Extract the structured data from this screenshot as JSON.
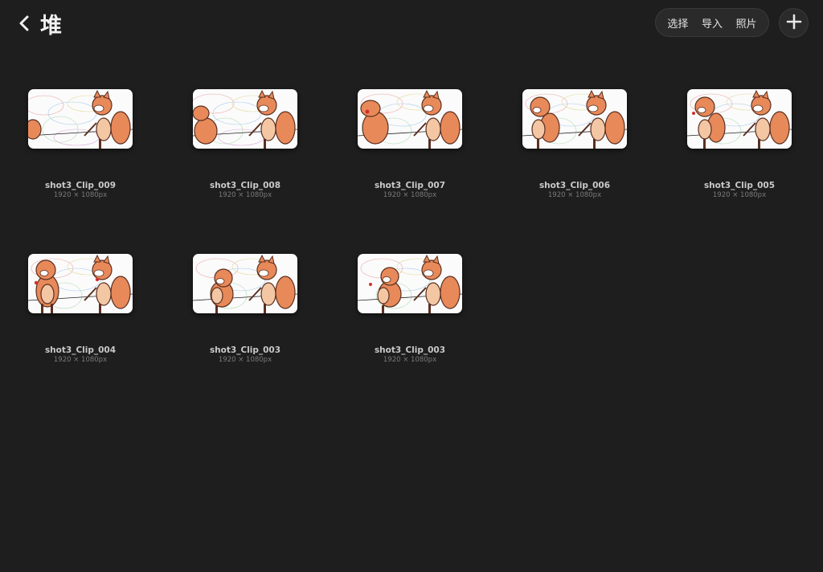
{
  "header": {
    "title": "堆",
    "buttons": {
      "select": "选择",
      "import": "导入",
      "photos": "照片"
    }
  },
  "colors": {
    "background": "#1e1e1e",
    "fox_orange": "#e8895a",
    "outline": "#5a2f20"
  },
  "icons": {
    "back": "chevron-left-icon",
    "add": "plus-icon"
  },
  "stack": {
    "items": [
      {
        "name": "shot3_Clip_009",
        "dims": "1920 × 1080px"
      },
      {
        "name": "shot3_Clip_008",
        "dims": "1920 × 1080px"
      },
      {
        "name": "shot3_Clip_007",
        "dims": "1920 × 1080px"
      },
      {
        "name": "shot3_Clip_006",
        "dims": "1920 × 1080px"
      },
      {
        "name": "shot3_Clip_005",
        "dims": "1920 × 1080px"
      },
      {
        "name": "shot3_Clip_004",
        "dims": "1920 × 1080px"
      },
      {
        "name": "shot3_Clip_003",
        "dims": "1920 × 1080px"
      },
      {
        "name": "shot3_Clip_003",
        "dims": "1920 × 1080px"
      }
    ]
  }
}
